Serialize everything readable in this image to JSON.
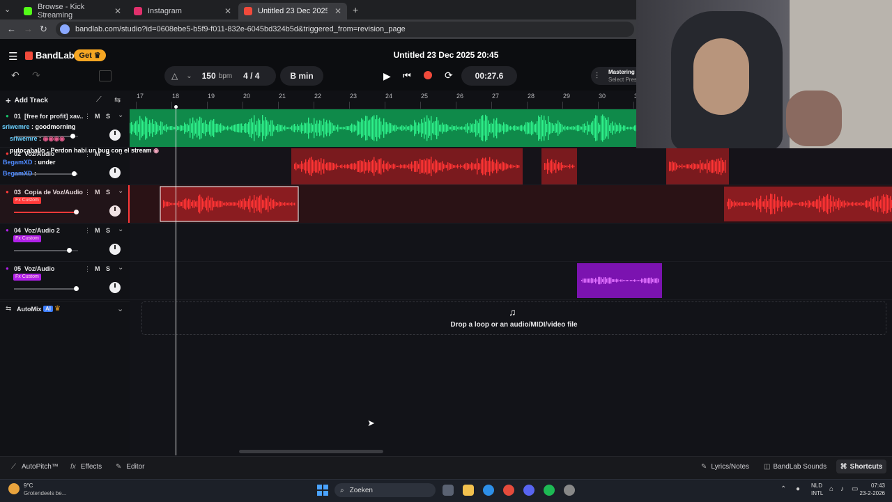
{
  "browser": {
    "tabs": [
      {
        "label": "Browse - Kick Streaming",
        "color": "#53fc18"
      },
      {
        "label": "Instagram",
        "color": "#e1306c"
      },
      {
        "label": "Untitled 23 Dec 2025 20:45",
        "color": "#f14a3b"
      }
    ],
    "url": "bandlab.com/studio?id=0608ebe5-b5f9-f011-832e-6045bd324b5d&triggered_from=revision_page"
  },
  "header": {
    "logo": "BandLab",
    "get_label": "Get",
    "project_title": "Untitled 23 Dec 2025 20:45",
    "bpm_value": "150",
    "bpm_unit": "bpm",
    "time_sig": "4 / 4",
    "key": "B min",
    "time_display": "00:27.6",
    "mastering_label": "Mastering",
    "mastering_sub": "Select Pres"
  },
  "toolbar": {
    "add_track": "Add Track"
  },
  "ruler": [
    "17",
    "18",
    "19",
    "20",
    "21",
    "22",
    "23",
    "24",
    "25",
    "26",
    "27",
    "28",
    "29",
    "30",
    "3"
  ],
  "tracks": [
    {
      "num": "01",
      "name": "[free for profit] xav...",
      "fx": "",
      "color": "#18c46b"
    },
    {
      "num": "02",
      "name": "Voz/Audio",
      "fx": "",
      "color": "#ff3a3a"
    },
    {
      "num": "03",
      "name": "Copia de Voz/Audio",
      "fx": "Fx Custom",
      "color": "#ff3a3a"
    },
    {
      "num": "04",
      "name": "Voz/Audio 2",
      "fx": "Fx Custom",
      "color": "#b020e8"
    },
    {
      "num": "05",
      "name": "Voz/Audio",
      "fx": "Fx Custom",
      "color": "#b020e8"
    }
  ],
  "mute_label": "M",
  "solo_label": "S",
  "automix": {
    "label": "AutoMix",
    "badge": "AI"
  },
  "drop_zone": "Drop a loop or an audio/MIDI/video file",
  "chat": [
    {
      "user": "sriwemre",
      "msg": "goodmorning",
      "color": "#6ad0ff"
    },
    {
      "user": "sriwemre",
      "msg": "",
      "color": "#6ad0ff"
    },
    {
      "user": "putocaballo",
      "msg": "Perdon habi un bug con el stream",
      "color": "#ffffff"
    },
    {
      "user": "BegamXD",
      "msg": "under",
      "color": "#4f8bff"
    },
    {
      "user": "BegamXD",
      "msg": "",
      "color": "#4f8bff"
    }
  ],
  "bottom": {
    "autopitch": "AutoPitch™",
    "effects": "Effects",
    "editor": "Editor",
    "lyrics": "Lyrics/Notes",
    "sounds": "BandLab Sounds",
    "shortcuts": "Shortcuts"
  },
  "taskbar": {
    "temp": "9°C",
    "weather": "Grotendeels be...",
    "search": "Zoeken",
    "lang1": "NLD",
    "lang2": "INTL",
    "time": "07:43",
    "date": "23-2-2026"
  }
}
